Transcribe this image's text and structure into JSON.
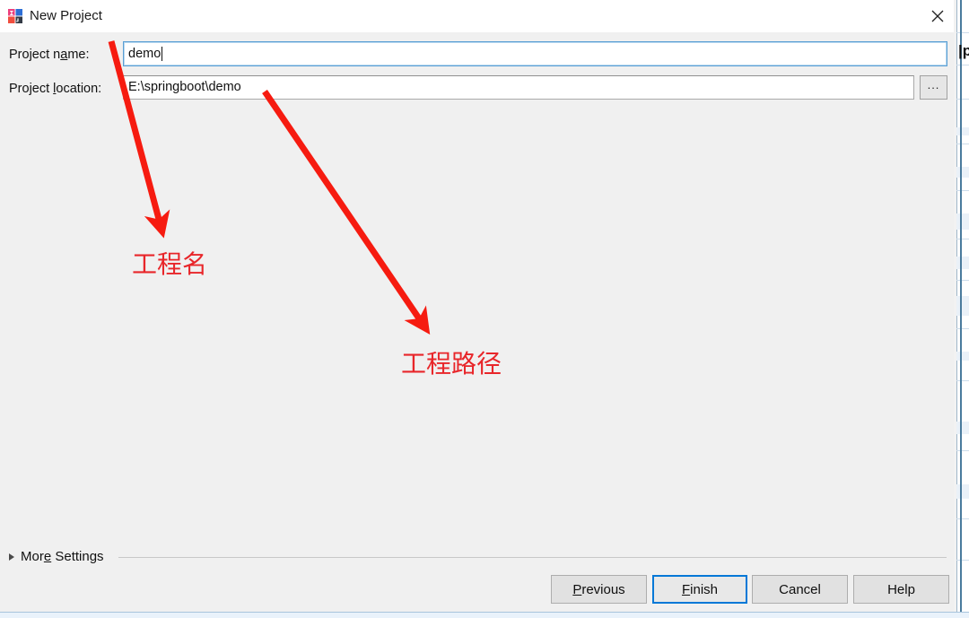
{
  "window": {
    "title": "New Project",
    "icon": "intellij-idea-logo-icon",
    "close_label": "✕"
  },
  "form": {
    "project_name": {
      "label_before": "Project n",
      "label_mnemonic": "a",
      "label_after": "me:",
      "value": "demo",
      "placeholder": ""
    },
    "project_location": {
      "label_before": "Project ",
      "label_mnemonic": "l",
      "label_after": "ocation:",
      "value": "E:\\springboot\\demo",
      "placeholder": "",
      "browse_label": "..."
    }
  },
  "annotations": [
    {
      "text": "工程名",
      "color": "#e8262a",
      "meaning": "project-name-annotation"
    },
    {
      "text": "工程路径",
      "color": "#e8262a",
      "meaning": "project-location-annotation"
    }
  ],
  "more_settings": {
    "label_before": "Mor",
    "label_mnemonic": "e",
    "label_after": " Settings",
    "expanded": false,
    "arrow_icon": "triangle-right-icon"
  },
  "buttons": {
    "previous": {
      "mnemonic": "P",
      "rest": "revious",
      "focused": false
    },
    "finish": {
      "mnemonic": "F",
      "rest": "inish",
      "focused": true
    },
    "cancel": {
      "mnemonic": "",
      "rest": "Cancel",
      "focused": false
    },
    "help": {
      "mnemonic": "",
      "rest": "Help",
      "focused": false
    }
  },
  "background_window": {
    "glyph": "|p"
  },
  "colors": {
    "accent": "#0078d7",
    "annotation_red": "#e8262a",
    "dialog_bg": "#f0f0f0",
    "field_focus_border": "#5a9fd4"
  }
}
